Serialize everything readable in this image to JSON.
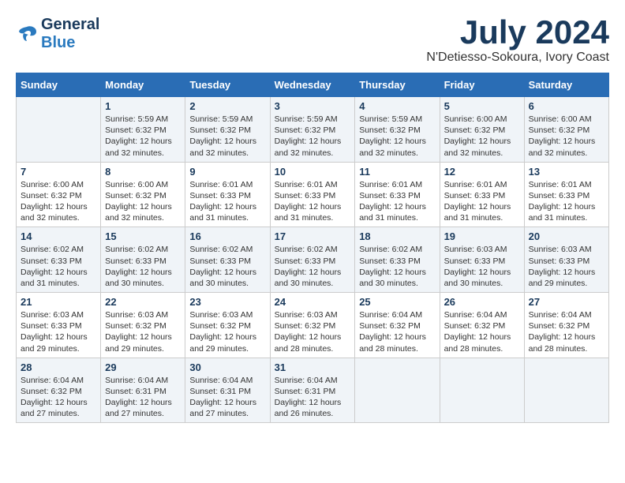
{
  "header": {
    "logo_line1": "General",
    "logo_line2": "Blue",
    "month": "July 2024",
    "location": "N'Detiesso-Sokoura, Ivory Coast"
  },
  "weekdays": [
    "Sunday",
    "Monday",
    "Tuesday",
    "Wednesday",
    "Thursday",
    "Friday",
    "Saturday"
  ],
  "weeks": [
    [
      {
        "day": "",
        "info": ""
      },
      {
        "day": "1",
        "info": "Sunrise: 5:59 AM\nSunset: 6:32 PM\nDaylight: 12 hours\nand 32 minutes."
      },
      {
        "day": "2",
        "info": "Sunrise: 5:59 AM\nSunset: 6:32 PM\nDaylight: 12 hours\nand 32 minutes."
      },
      {
        "day": "3",
        "info": "Sunrise: 5:59 AM\nSunset: 6:32 PM\nDaylight: 12 hours\nand 32 minutes."
      },
      {
        "day": "4",
        "info": "Sunrise: 5:59 AM\nSunset: 6:32 PM\nDaylight: 12 hours\nand 32 minutes."
      },
      {
        "day": "5",
        "info": "Sunrise: 6:00 AM\nSunset: 6:32 PM\nDaylight: 12 hours\nand 32 minutes."
      },
      {
        "day": "6",
        "info": "Sunrise: 6:00 AM\nSunset: 6:32 PM\nDaylight: 12 hours\nand 32 minutes."
      }
    ],
    [
      {
        "day": "7",
        "info": "Sunrise: 6:00 AM\nSunset: 6:32 PM\nDaylight: 12 hours\nand 32 minutes."
      },
      {
        "day": "8",
        "info": "Sunrise: 6:00 AM\nSunset: 6:32 PM\nDaylight: 12 hours\nand 32 minutes."
      },
      {
        "day": "9",
        "info": "Sunrise: 6:01 AM\nSunset: 6:33 PM\nDaylight: 12 hours\nand 31 minutes."
      },
      {
        "day": "10",
        "info": "Sunrise: 6:01 AM\nSunset: 6:33 PM\nDaylight: 12 hours\nand 31 minutes."
      },
      {
        "day": "11",
        "info": "Sunrise: 6:01 AM\nSunset: 6:33 PM\nDaylight: 12 hours\nand 31 minutes."
      },
      {
        "day": "12",
        "info": "Sunrise: 6:01 AM\nSunset: 6:33 PM\nDaylight: 12 hours\nand 31 minutes."
      },
      {
        "day": "13",
        "info": "Sunrise: 6:01 AM\nSunset: 6:33 PM\nDaylight: 12 hours\nand 31 minutes."
      }
    ],
    [
      {
        "day": "14",
        "info": "Sunrise: 6:02 AM\nSunset: 6:33 PM\nDaylight: 12 hours\nand 31 minutes."
      },
      {
        "day": "15",
        "info": "Sunrise: 6:02 AM\nSunset: 6:33 PM\nDaylight: 12 hours\nand 30 minutes."
      },
      {
        "day": "16",
        "info": "Sunrise: 6:02 AM\nSunset: 6:33 PM\nDaylight: 12 hours\nand 30 minutes."
      },
      {
        "day": "17",
        "info": "Sunrise: 6:02 AM\nSunset: 6:33 PM\nDaylight: 12 hours\nand 30 minutes."
      },
      {
        "day": "18",
        "info": "Sunrise: 6:02 AM\nSunset: 6:33 PM\nDaylight: 12 hours\nand 30 minutes."
      },
      {
        "day": "19",
        "info": "Sunrise: 6:03 AM\nSunset: 6:33 PM\nDaylight: 12 hours\nand 30 minutes."
      },
      {
        "day": "20",
        "info": "Sunrise: 6:03 AM\nSunset: 6:33 PM\nDaylight: 12 hours\nand 29 minutes."
      }
    ],
    [
      {
        "day": "21",
        "info": "Sunrise: 6:03 AM\nSunset: 6:33 PM\nDaylight: 12 hours\nand 29 minutes."
      },
      {
        "day": "22",
        "info": "Sunrise: 6:03 AM\nSunset: 6:32 PM\nDaylight: 12 hours\nand 29 minutes."
      },
      {
        "day": "23",
        "info": "Sunrise: 6:03 AM\nSunset: 6:32 PM\nDaylight: 12 hours\nand 29 minutes."
      },
      {
        "day": "24",
        "info": "Sunrise: 6:03 AM\nSunset: 6:32 PM\nDaylight: 12 hours\nand 28 minutes."
      },
      {
        "day": "25",
        "info": "Sunrise: 6:04 AM\nSunset: 6:32 PM\nDaylight: 12 hours\nand 28 minutes."
      },
      {
        "day": "26",
        "info": "Sunrise: 6:04 AM\nSunset: 6:32 PM\nDaylight: 12 hours\nand 28 minutes."
      },
      {
        "day": "27",
        "info": "Sunrise: 6:04 AM\nSunset: 6:32 PM\nDaylight: 12 hours\nand 28 minutes."
      }
    ],
    [
      {
        "day": "28",
        "info": "Sunrise: 6:04 AM\nSunset: 6:32 PM\nDaylight: 12 hours\nand 27 minutes."
      },
      {
        "day": "29",
        "info": "Sunrise: 6:04 AM\nSunset: 6:31 PM\nDaylight: 12 hours\nand 27 minutes."
      },
      {
        "day": "30",
        "info": "Sunrise: 6:04 AM\nSunset: 6:31 PM\nDaylight: 12 hours\nand 27 minutes."
      },
      {
        "day": "31",
        "info": "Sunrise: 6:04 AM\nSunset: 6:31 PM\nDaylight: 12 hours\nand 26 minutes."
      },
      {
        "day": "",
        "info": ""
      },
      {
        "day": "",
        "info": ""
      },
      {
        "day": "",
        "info": ""
      }
    ]
  ],
  "shaded_rows": [
    0,
    2,
    4
  ]
}
